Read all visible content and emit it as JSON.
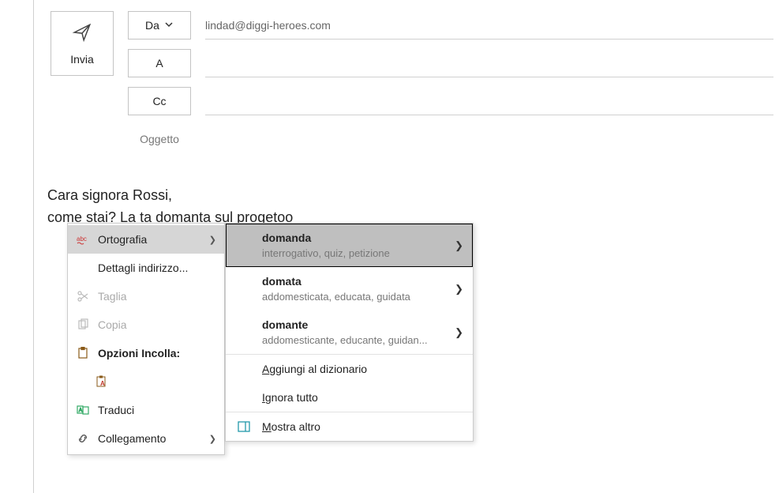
{
  "send": {
    "label": "Invia"
  },
  "header": {
    "from_label": "Da",
    "from_value": "lindad@diggi-heroes.com",
    "to_label": "A",
    "to_value": "",
    "cc_label": "Cc",
    "cc_value": "",
    "subject_label": "Oggetto",
    "subject_value": ""
  },
  "body": {
    "line1": "Cara signora Rossi,",
    "line2a": "come stai? La ",
    "line2b": "ta",
    "line2c": " ",
    "line2d": "domanta",
    "line2e": " sul ",
    "line2f": "progetoo"
  },
  "ctx": {
    "spelling": "Ortografia",
    "address_details": "Dettagli indirizzo...",
    "cut": "Taglia",
    "copy": "Copia",
    "paste_options": "Opzioni Incolla:",
    "translate": "Traduci",
    "link": "Collegamento"
  },
  "spell": {
    "suggestions": [
      {
        "word": "domanda",
        "syn": "interrogativo, quiz, petizione"
      },
      {
        "word": "domata",
        "syn": "addomesticata, educata, guidata"
      },
      {
        "word": "domante",
        "syn": "addomesticante, educante, guidan..."
      }
    ],
    "add_to_dict": "Aggiungi al dizionario",
    "ignore_all": "Ignora tutto",
    "show_more": "Mostra altro"
  }
}
